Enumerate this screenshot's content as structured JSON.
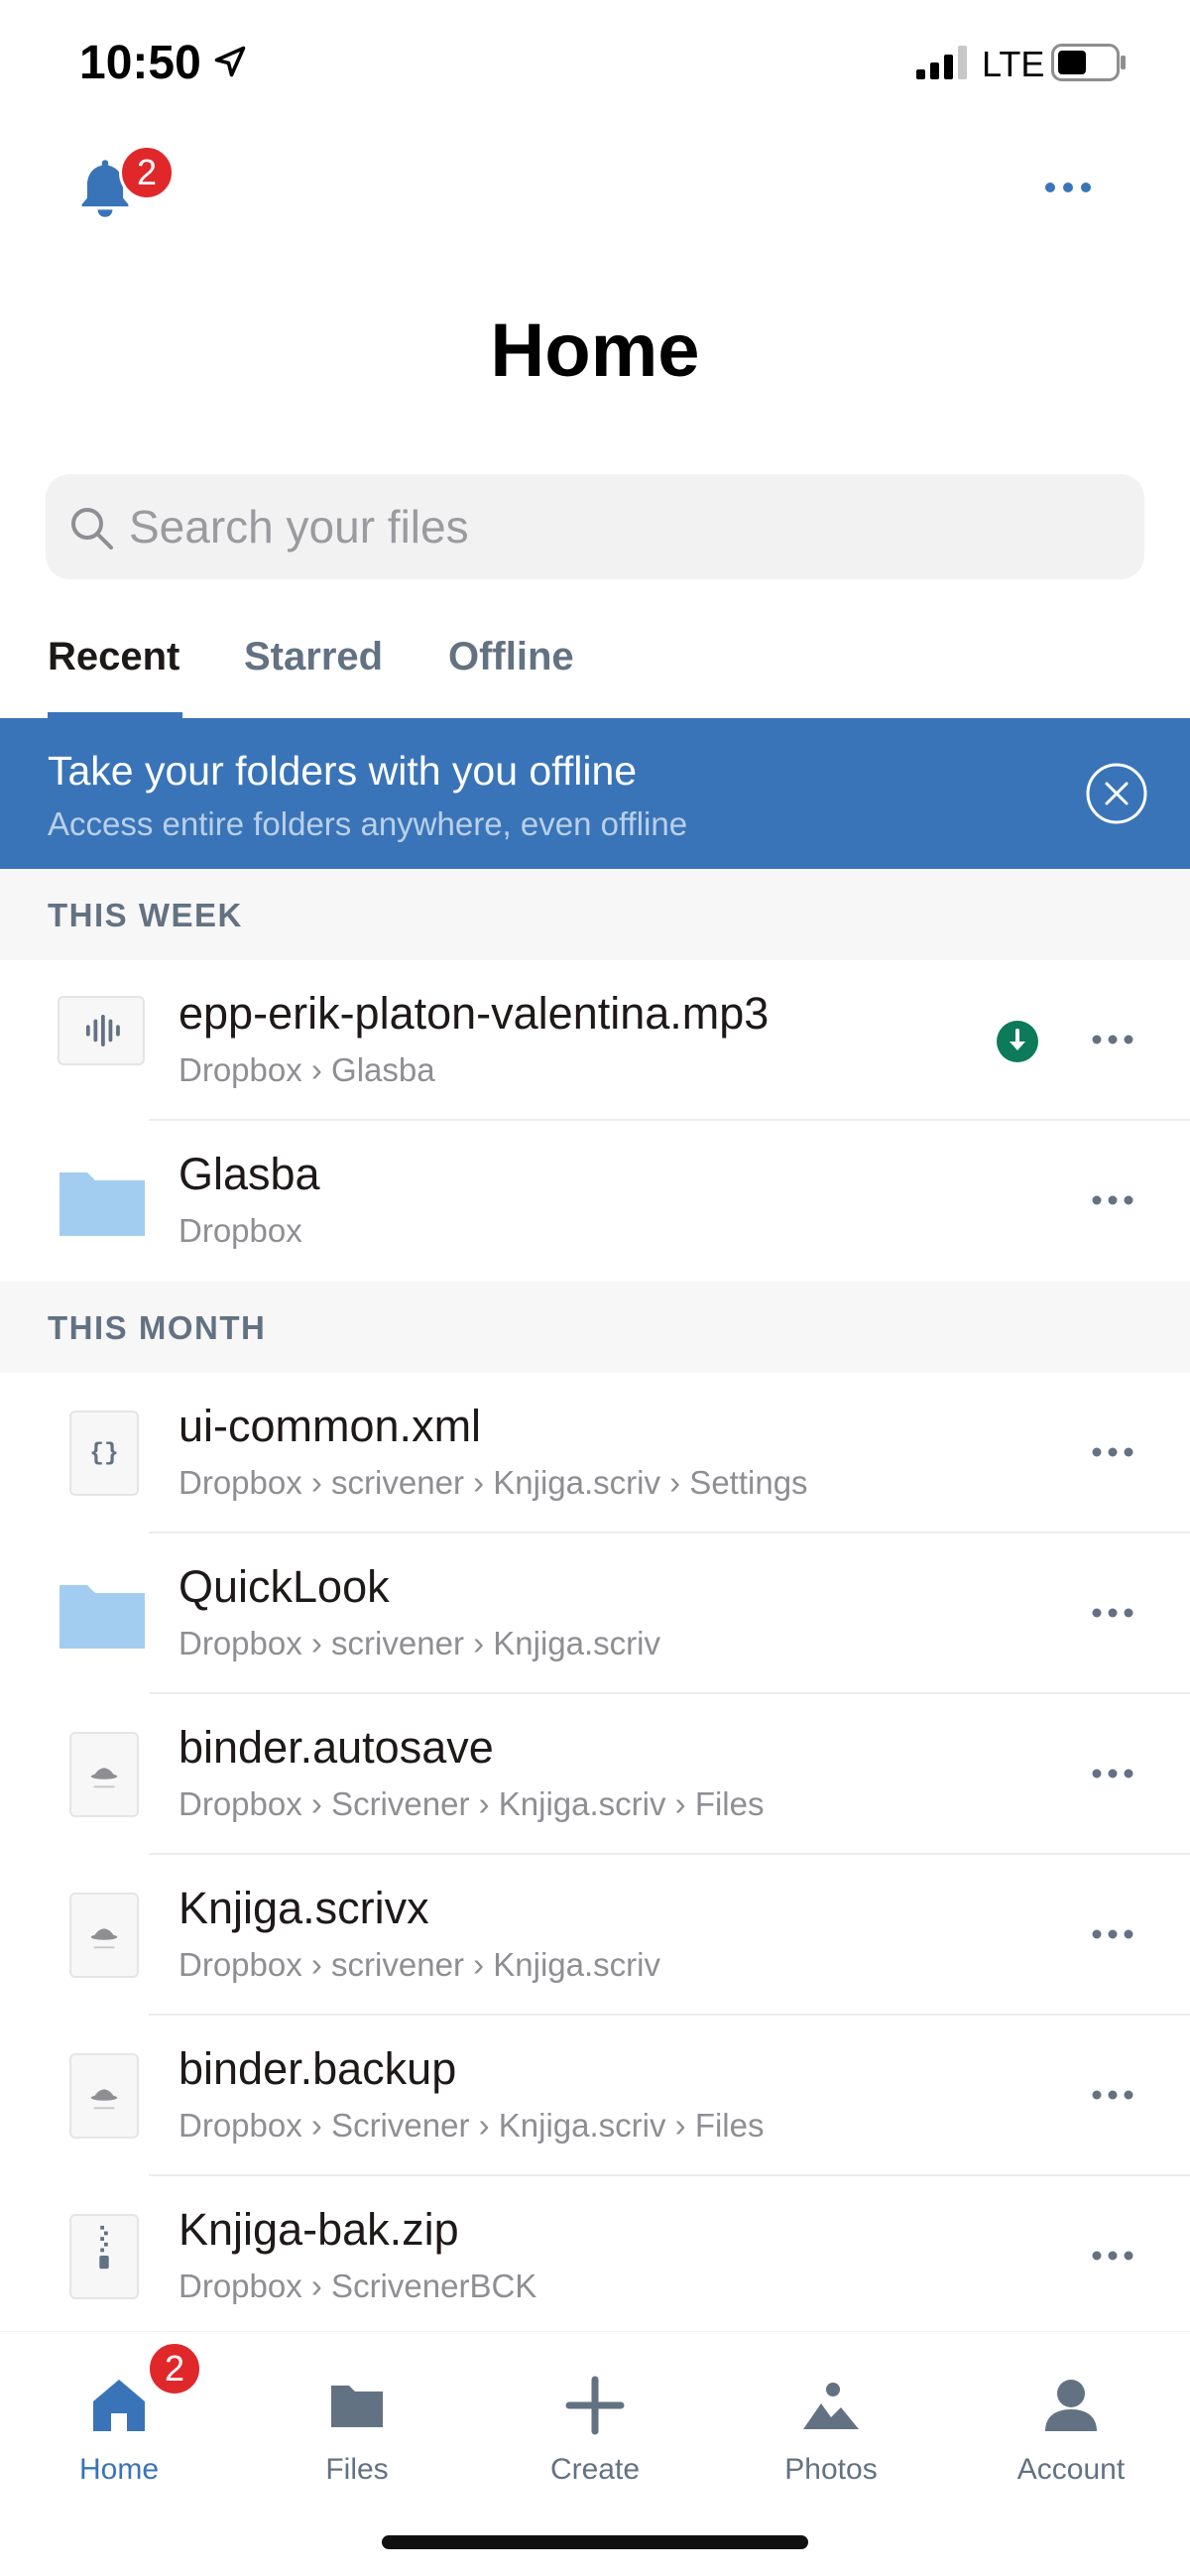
{
  "status": {
    "time": "10:50",
    "network": "LTE"
  },
  "notifications": {
    "badge": "2"
  },
  "page": {
    "title": "Home"
  },
  "search": {
    "placeholder": "Search your files"
  },
  "tabs": {
    "recent": "Recent",
    "starred": "Starred",
    "offline": "Offline"
  },
  "banner": {
    "title": "Take your folders with you offline",
    "subtitle": "Access entire folders anywhere, even offline"
  },
  "sections": {
    "this_week": "THIS WEEK",
    "this_month": "THIS MONTH"
  },
  "files": [
    {
      "name": "epp-erik-platon-valentina.mp3",
      "path": "Dropbox › Glasba",
      "icon": "audio-file-icon",
      "offline": true
    },
    {
      "name": "Glasba",
      "path": "Dropbox",
      "icon": "folder-icon",
      "offline": false
    },
    {
      "name": "ui-common.xml",
      "path": "Dropbox › scrivener › Knjiga.scriv › Settings",
      "icon": "code-file-icon",
      "offline": false
    },
    {
      "name": "QuickLook",
      "path": "Dropbox › scrivener › Knjiga.scriv",
      "icon": "folder-icon",
      "offline": false
    },
    {
      "name": "binder.autosave",
      "path": "Dropbox › Scrivener › Knjiga.scriv › Files",
      "icon": "generic-file-icon",
      "offline": false
    },
    {
      "name": "Knjiga.scrivx",
      "path": "Dropbox › scrivener › Knjiga.scriv",
      "icon": "generic-file-icon",
      "offline": false
    },
    {
      "name": "binder.backup",
      "path": "Dropbox › Scrivener › Knjiga.scriv › Files",
      "icon": "generic-file-icon",
      "offline": false
    },
    {
      "name": "Knjiga-bak.zip",
      "path": "Dropbox › ScrivenerBCK",
      "icon": "zip-file-icon",
      "offline": false
    }
  ],
  "tabbar": {
    "home": "Home",
    "files": "Files",
    "create": "Create",
    "photos": "Photos",
    "account": "Account",
    "home_badge": "2"
  },
  "colors": {
    "accent": "#3a74b8",
    "badge": "#e0282b",
    "offline_indicator": "#0d7a5a",
    "folder": "#a3cdf0"
  }
}
